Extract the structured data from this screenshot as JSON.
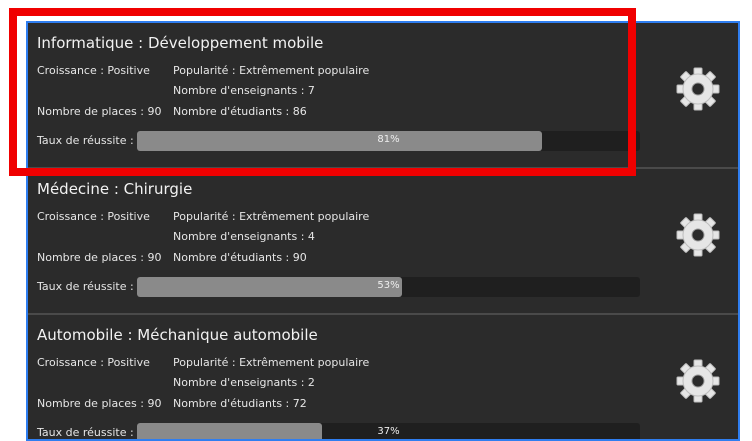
{
  "courses": [
    {
      "title": "Informatique : Développement mobile",
      "croissance": "Croissance : Positive",
      "popularite": "Popularité : Extrêmement populaire",
      "enseignants": "Nombre d'enseignants : 7",
      "places": "Nombre de places : 90",
      "etudiants": "Nombre d'étudiants : 86",
      "taux_label": "Taux de réussite :",
      "taux_value": 81,
      "taux_text": "81%"
    },
    {
      "title": "Médecine : Chirurgie",
      "croissance": "Croissance : Positive",
      "popularite": "Popularité : Extrêmement populaire",
      "enseignants": "Nombre d'enseignants : 4",
      "places": "Nombre de places : 90",
      "etudiants": "Nombre d'étudiants : 90",
      "taux_label": "Taux de réussite :",
      "taux_value": 53,
      "taux_text": "53%"
    },
    {
      "title": "Automobile : Méchanique automobile",
      "croissance": "Croissance : Positive",
      "popularite": "Popularité : Extrêmement populaire",
      "enseignants": "Nombre d'enseignants : 2",
      "places": "Nombre de places : 90",
      "etudiants": "Nombre d'étudiants : 72",
      "taux_label": "Taux de réussite :",
      "taux_value": 37,
      "taux_text": "37%"
    }
  ],
  "icons": {
    "settings": "gear-icon"
  },
  "colors": {
    "highlight": "#f00000",
    "list_border": "#2f7ef0",
    "progress_fill": "#8a8a8a"
  }
}
